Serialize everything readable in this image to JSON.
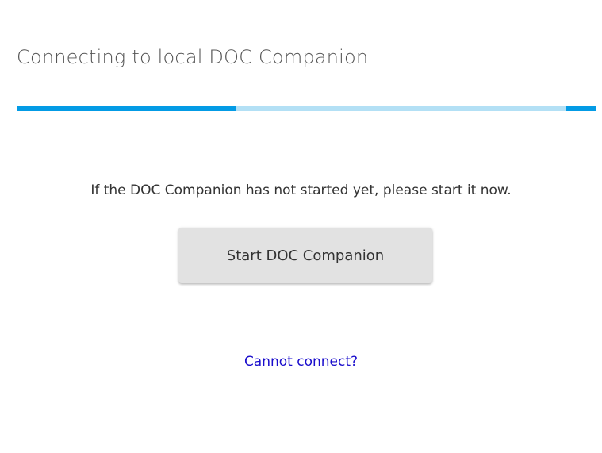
{
  "dialog": {
    "title": "Connecting to local DOC Companion",
    "progress": {
      "state": "indeterminate",
      "bar_color": "#039be5",
      "track_color": "#b3e0f5"
    },
    "message": "If the DOC Companion has not started yet, please start it now.",
    "start_button_label": "Start DOC Companion",
    "help_link_text": "Cannot connect?"
  }
}
